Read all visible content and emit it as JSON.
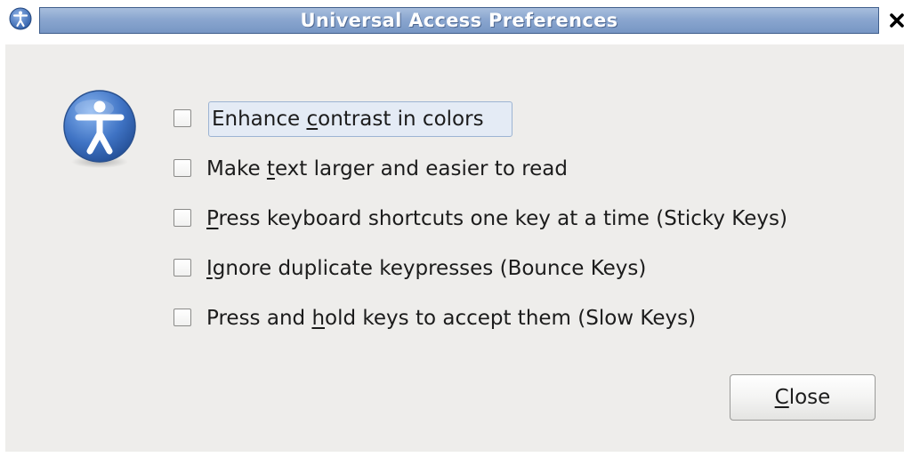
{
  "window": {
    "title": "Universal Access Preferences",
    "menu_icon": "accessibility-icon",
    "close_icon": "close-icon",
    "title_bar_color": "#8aa6cf"
  },
  "dialog": {
    "app_icon": "accessibility-icon",
    "accent_color": "#3f73c4",
    "options": [
      {
        "pre": "Enhance ",
        "mnemonic": "c",
        "post": "ontrast in colors",
        "checked": false,
        "focused": true
      },
      {
        "pre": "Make ",
        "mnemonic": "t",
        "post": "ext larger and easier to read",
        "checked": false,
        "focused": false
      },
      {
        "pre": "",
        "mnemonic": "P",
        "post": "ress keyboard shortcuts one key at a time (Sticky Keys)",
        "checked": false,
        "focused": false
      },
      {
        "pre": "",
        "mnemonic": "I",
        "post": "gnore duplicate keypresses (Bounce Keys)",
        "checked": false,
        "focused": false
      },
      {
        "pre": "Press and ",
        "mnemonic": "h",
        "post": "old keys to accept them (Slow Keys)",
        "checked": false,
        "focused": false
      }
    ],
    "close_button": {
      "mnemonic": "C",
      "rest": "lose"
    }
  }
}
